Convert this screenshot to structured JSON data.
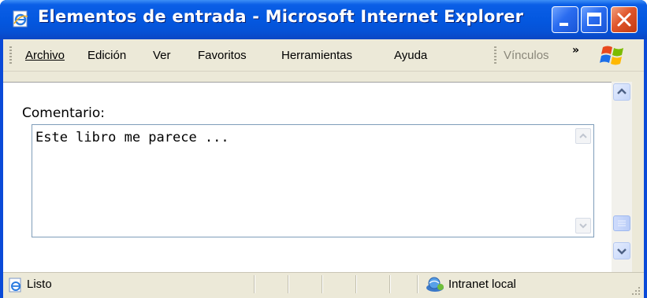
{
  "window": {
    "title": "Elementos de entrada - Microsoft Internet Explorer",
    "buttons": [
      "minimize-icon",
      "maximize-icon",
      "close-icon"
    ]
  },
  "menubar": {
    "items": [
      {
        "label": "Archivo"
      },
      {
        "label": "Edición"
      },
      {
        "label": "Ver"
      },
      {
        "label": "Favoritos"
      },
      {
        "label": "Herramientas"
      },
      {
        "label": "Ayuda"
      }
    ],
    "links_label": "Vínculos",
    "chevron": "»"
  },
  "form": {
    "label": "Comentario:",
    "textarea_value": "Este libro me parece ..."
  },
  "statusbar": {
    "status": "Listo",
    "zone": "Intranet local"
  },
  "colors": {
    "titlebar": "#0458e0",
    "chrome": "#ece9d8",
    "close_button": "#e0552a"
  }
}
